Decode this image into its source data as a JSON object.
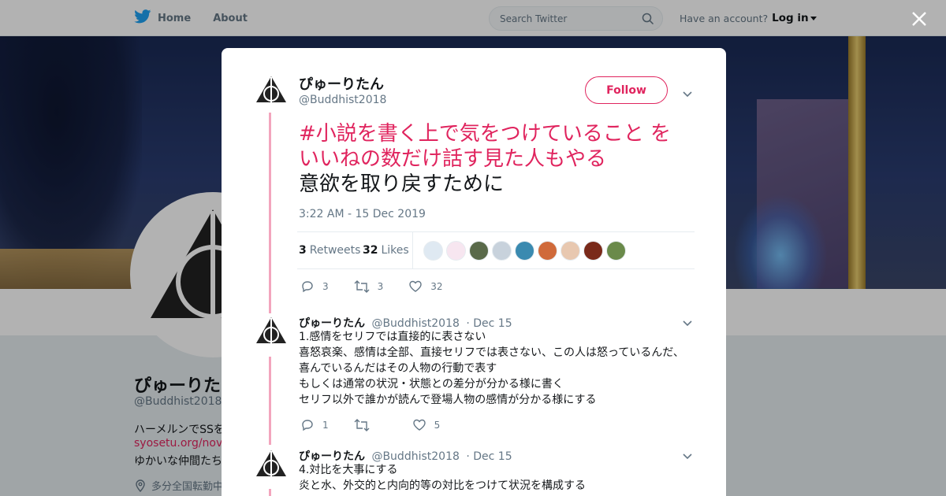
{
  "nav": {
    "home_label": "Home",
    "about_label": "About",
    "search_placeholder": "Search Twitter",
    "account_prompt": "Have an account?",
    "login_label": "Log in"
  },
  "background_profile": {
    "name": "ぴゅーりたん",
    "handle": "@Buddhist2018",
    "bio_line1": "ハーメルンでSSを",
    "link": "syosetu.org/novel",
    "bio_line2": "ゆかいな仲間たち",
    "location": "多分全国転勤中"
  },
  "main_tweet": {
    "name": "ぴゅーりたん",
    "handle": "@Buddhist2018",
    "follow_label": "Follow",
    "hashtag_line1": "#小説を書く上で気をつけていること",
    "hashtag_line1_tail": " を",
    "hashtag_line2": "いいねの数だけ話す見た人もやる",
    "text_line3": "意欲を取り戻すために",
    "timestamp": "3:22 AM - 15 Dec 2019",
    "retweets_count": "3",
    "retweets_label": "Retweets",
    "likes_count": "32",
    "likes_label": "Likes",
    "reply_count": "3",
    "retweet_action_count": "3",
    "like_action_count": "32"
  },
  "replies": [
    {
      "name": "ぴゅーりたん",
      "handle": "@Buddhist2018",
      "date": "· Dec 15",
      "lines": [
        "1.感情をセリフでは直接的に表さない",
        "喜怒哀楽、感情は全部、直接セリフでは表さない、この人は怒っているんだ、",
        "喜んでいるんだはその人物の行動で表す",
        "もしくは通常の状況・状態との差分が分かる様に書く",
        "セリフ以外で誰かが読んで登場人物の感情が分かる様にする"
      ],
      "reply_count": "1",
      "retweet_count": "",
      "like_count": "5"
    },
    {
      "name": "ぴゅーりたん",
      "handle": "@Buddhist2018",
      "date": "· Dec 15",
      "lines": [
        "4.対比を大事にする",
        "炎と水、外交的と内向的等の対比をつけて状況を構成する"
      ]
    }
  ],
  "colors": {
    "accent": "#e0245e",
    "thread_line": "#f2a5bd",
    "muted": "#657786",
    "twitter_blue": "#1da1f2"
  },
  "liker_colors": [
    "#dfe9f2",
    "#f7e6f0",
    "#5a6a4a",
    "#c8d2dc",
    "#3a8ab0",
    "#d06a3a",
    "#e8c8b0",
    "#7a2a1a",
    "#6a8a4a"
  ]
}
